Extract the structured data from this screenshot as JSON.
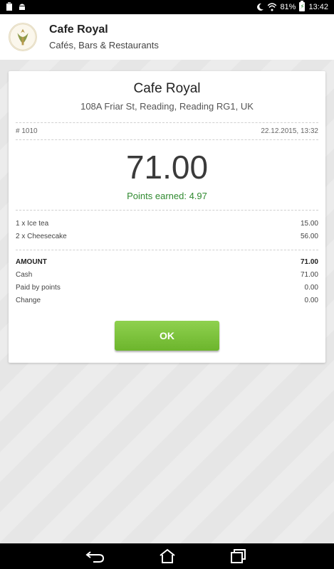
{
  "status_bar": {
    "battery": "81%",
    "time": "13:42"
  },
  "header": {
    "title": "Cafe Royal",
    "subtitle": "Cafés, Bars & Restaurants"
  },
  "receipt": {
    "shop_name": "Cafe Royal",
    "address": "108A Friar St, Reading, Reading RG1, UK",
    "number": "# 1010",
    "datetime": "22.12.2015, 13:32",
    "total": "71.00",
    "points_earned": "Points earned: 4.97",
    "items": [
      {
        "label": "1 x Ice tea",
        "value": "15.00"
      },
      {
        "label": "2 x Cheesecake",
        "value": "56.00"
      }
    ],
    "summary": [
      {
        "label": "AMOUNT",
        "value": "71.00"
      },
      {
        "label": "Cash",
        "value": "71.00"
      },
      {
        "label": "Paid by points",
        "value": "0.00"
      },
      {
        "label": "Change",
        "value": "0.00"
      }
    ],
    "ok_label": "OK"
  },
  "colors": {
    "accent_green": "#7cc43c",
    "points_green": "#2f8a2f"
  },
  "icons": [
    "clipboard-icon",
    "android-icon",
    "moon-icon",
    "wifi-icon",
    "battery-icon",
    "back-icon",
    "home-icon",
    "recent-apps-icon"
  ]
}
